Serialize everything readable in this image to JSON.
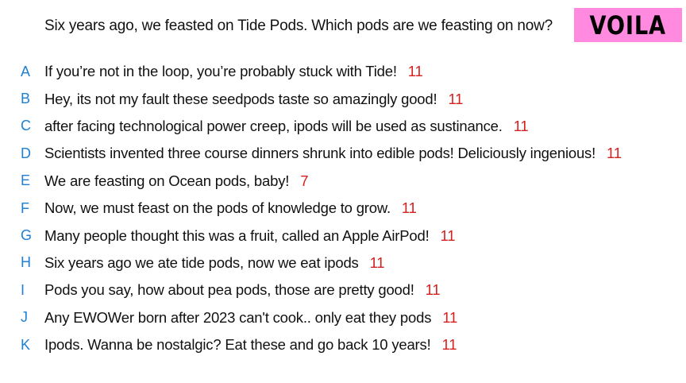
{
  "prompt": {
    "question": "Six years ago, we feasted on Tide Pods. Which pods are we feasting on now?"
  },
  "badge": {
    "label": "VOILA",
    "color": "#ff8ae0"
  },
  "colors": {
    "letter": "#1d7fd6",
    "count": "#d61f1f"
  },
  "answers": [
    {
      "letter": "A",
      "text": "If you’re not in the loop, you’re probably stuck with Tide!",
      "count": "11"
    },
    {
      "letter": "B",
      "text": "Hey, its not my fault these seedpods taste so amazingly good!",
      "count": "11"
    },
    {
      "letter": "C",
      "text": "after facing technological power creep, ipods will be used as sustinance.",
      "count": "11"
    },
    {
      "letter": "D",
      "text": "Scientists invented three course dinners shrunk into edible pods! Deliciously ingenious!",
      "count": "11"
    },
    {
      "letter": "E",
      "text": "We are feasting on Ocean pods, baby!",
      "count": "7"
    },
    {
      "letter": "F",
      "text": "Now, we must feast on the pods of knowledge to grow.",
      "count": "11"
    },
    {
      "letter": "G",
      "text": "Many people thought this was a fruit, called an Apple AirPod!",
      "count": "11"
    },
    {
      "letter": "H",
      "text": "Six years ago we ate tide pods, now we eat ipods",
      "count": "11"
    },
    {
      "letter": "I",
      "text": "Pods you say, how about pea pods, those are pretty good!",
      "count": "11"
    },
    {
      "letter": "J",
      "text": "Any EWOWer born after 2023 can't cook.. only eat they pods",
      "count": "11"
    },
    {
      "letter": "K",
      "text": "Ipods. Wanna be nostalgic? Eat these and go back 10 years!",
      "count": "11"
    }
  ]
}
